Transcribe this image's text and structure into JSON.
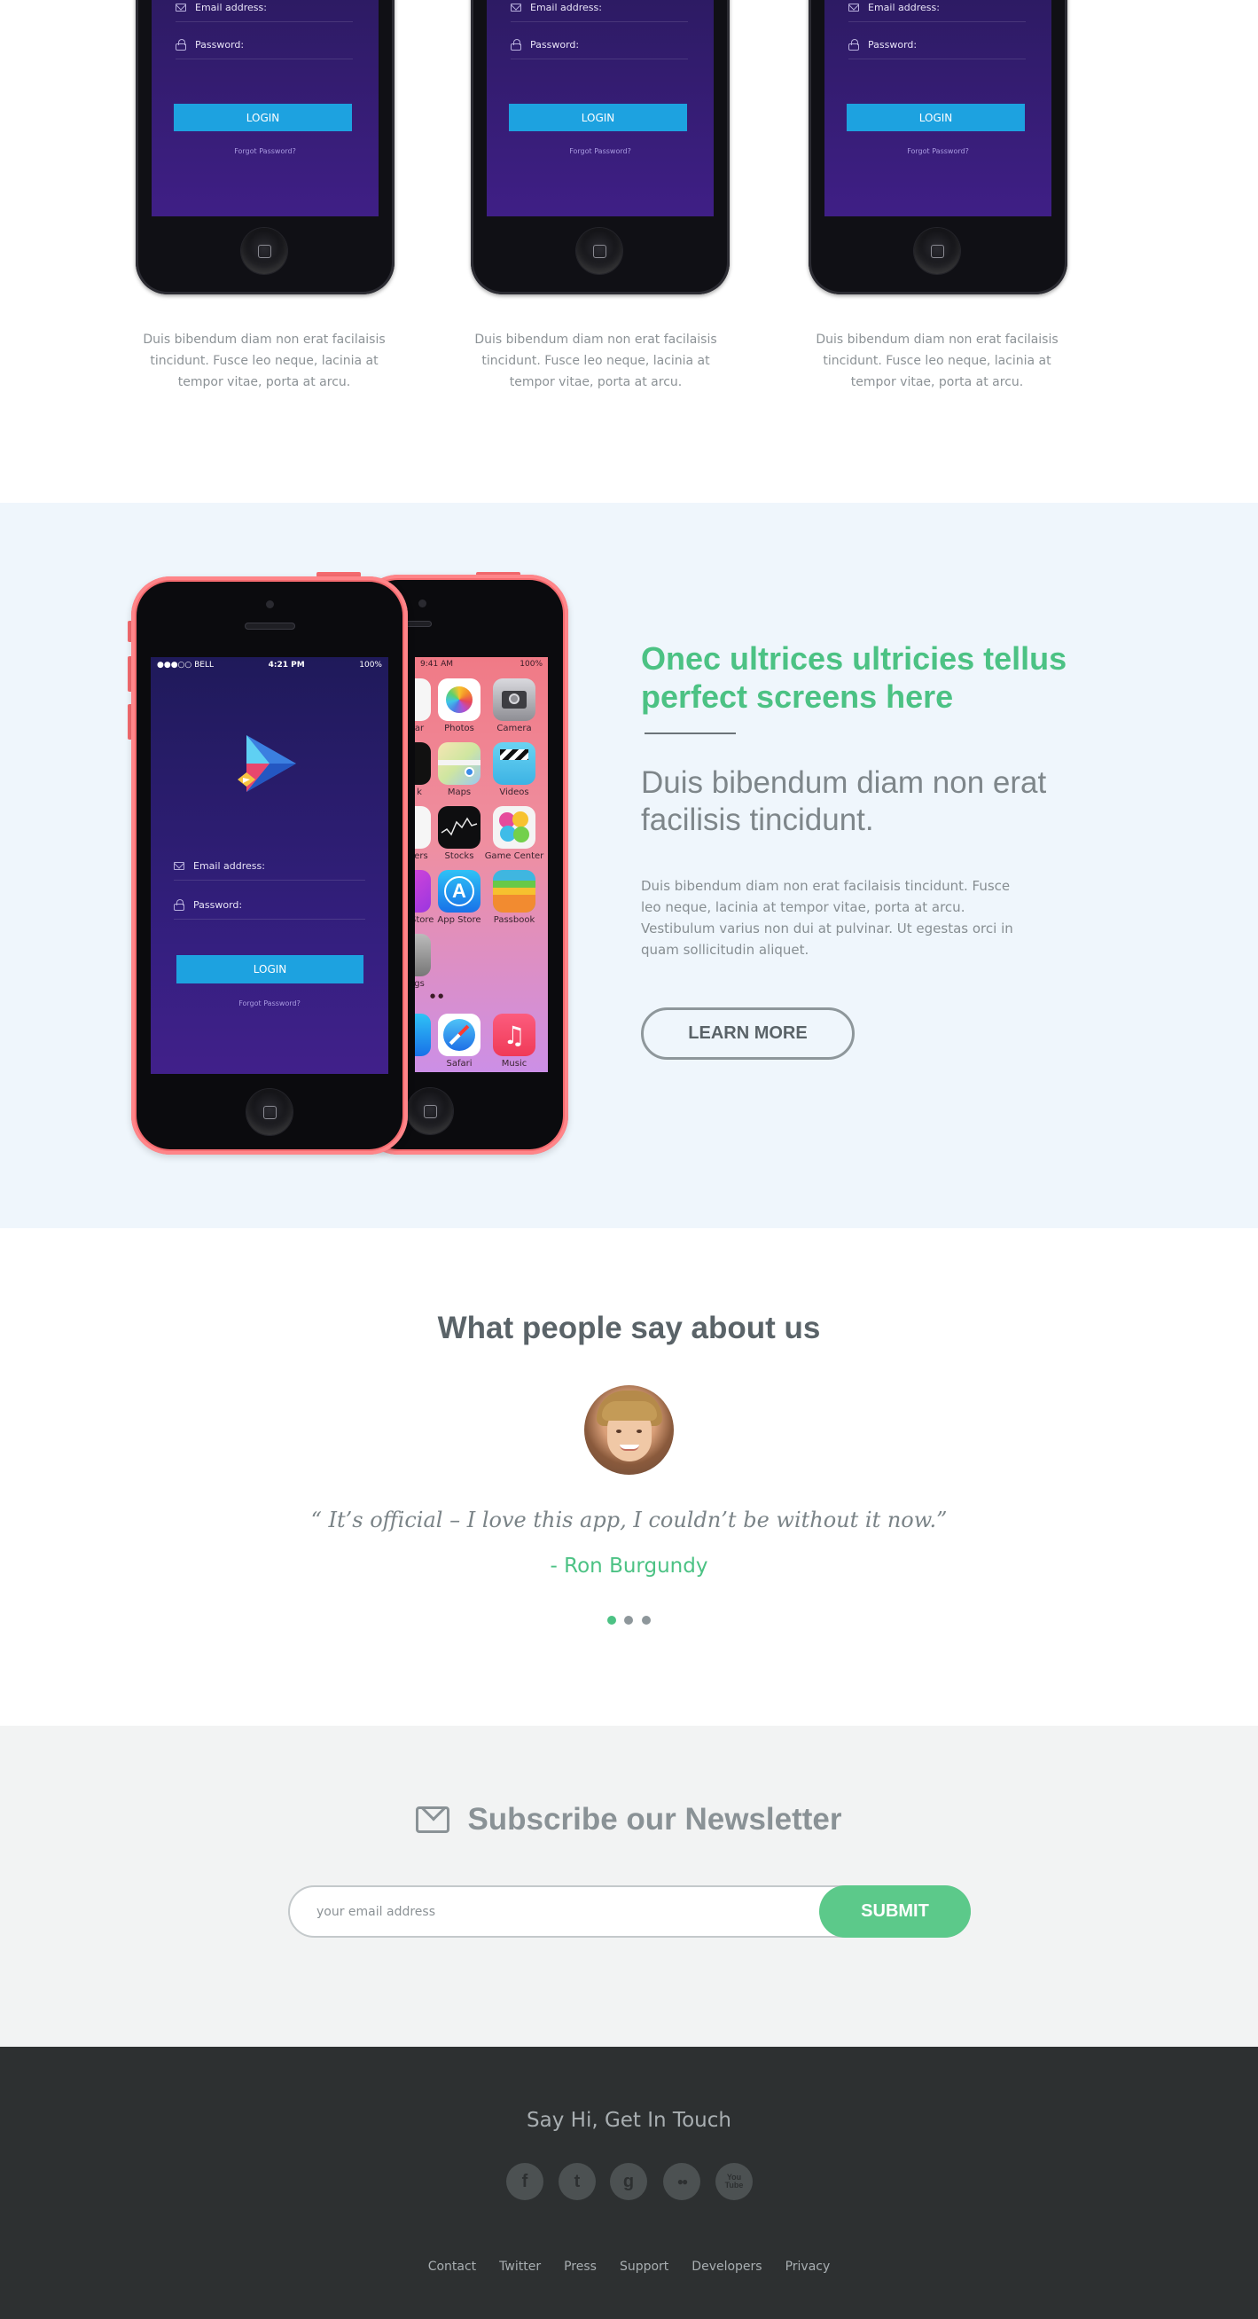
{
  "phones": {
    "email_label": "Email address:",
    "password_label": "Password:",
    "login_label": "LOGIN",
    "forgot_label": "Forgot Password?",
    "captions": [
      "Duis bibendum diam non erat facilaisis tincidunt. Fusce leo neque, lacinia at tempor vitae, porta at arcu.",
      "Duis bibendum diam non erat facilaisis tincidunt. Fusce leo neque, lacinia at tempor vitae, porta at arcu.",
      "Duis bibendum diam non erat facilaisis tincidunt. Fusce leo neque, lacinia at tempor vitae, porta at arcu."
    ]
  },
  "feature": {
    "status_carrier": "●●●○○ BELL",
    "status_time": "4:21 PM",
    "status_battery": "100%",
    "back_status_time": "9:41 AM",
    "back_status_battery": "100%",
    "apps": [
      "Photos",
      "Camera",
      "Maps",
      "Videos",
      "Stocks",
      "Game Center",
      "App Store",
      "Passbook",
      "Safari",
      "Music"
    ],
    "partial_labels": [
      "ar",
      "k",
      "ers",
      "Store",
      "gs"
    ],
    "title": "Onec ultrices ultricies tellus perfect screens here",
    "subtitle": "Duis bibendum diam non erat facilisis tincidunt.",
    "body": "Duis bibendum diam non erat facilaisis tincidunt. Fusce leo neque, lacinia at tempor vitae, porta at arcu. Vestibulum varius non dui at pulvinar. Ut egestas orci in quam sollicitudin aliquet.",
    "cta": "LEARN MORE"
  },
  "testimonials": {
    "heading": "What people say about us",
    "quote": "“ It’s official – I love this app, I couldn’t be without it now.”",
    "author": "- Ron Burgundy",
    "dots": 3,
    "active_dot": 0
  },
  "newsletter": {
    "title": "Subscribe our Newsletter",
    "placeholder": "your email address",
    "submit": "SUBMIT"
  },
  "footer": {
    "tagline": "Say Hi, Get In Touch",
    "social_icons": [
      "facebook-icon",
      "twitter-icon",
      "google-plus-icon",
      "flickr-icon",
      "youtube-icon"
    ],
    "social_glyphs": [
      "f",
      "t",
      "g",
      "●●",
      "You\nTube"
    ],
    "links": [
      "Contact",
      "Twitter",
      "Press",
      "Support",
      "Developers",
      "Privacy"
    ]
  },
  "colors": {
    "accent_green": "#4cc284",
    "login_blue": "#1da2e0",
    "phone_pink": "#f46b6f",
    "footer_bg": "#2d3031"
  }
}
